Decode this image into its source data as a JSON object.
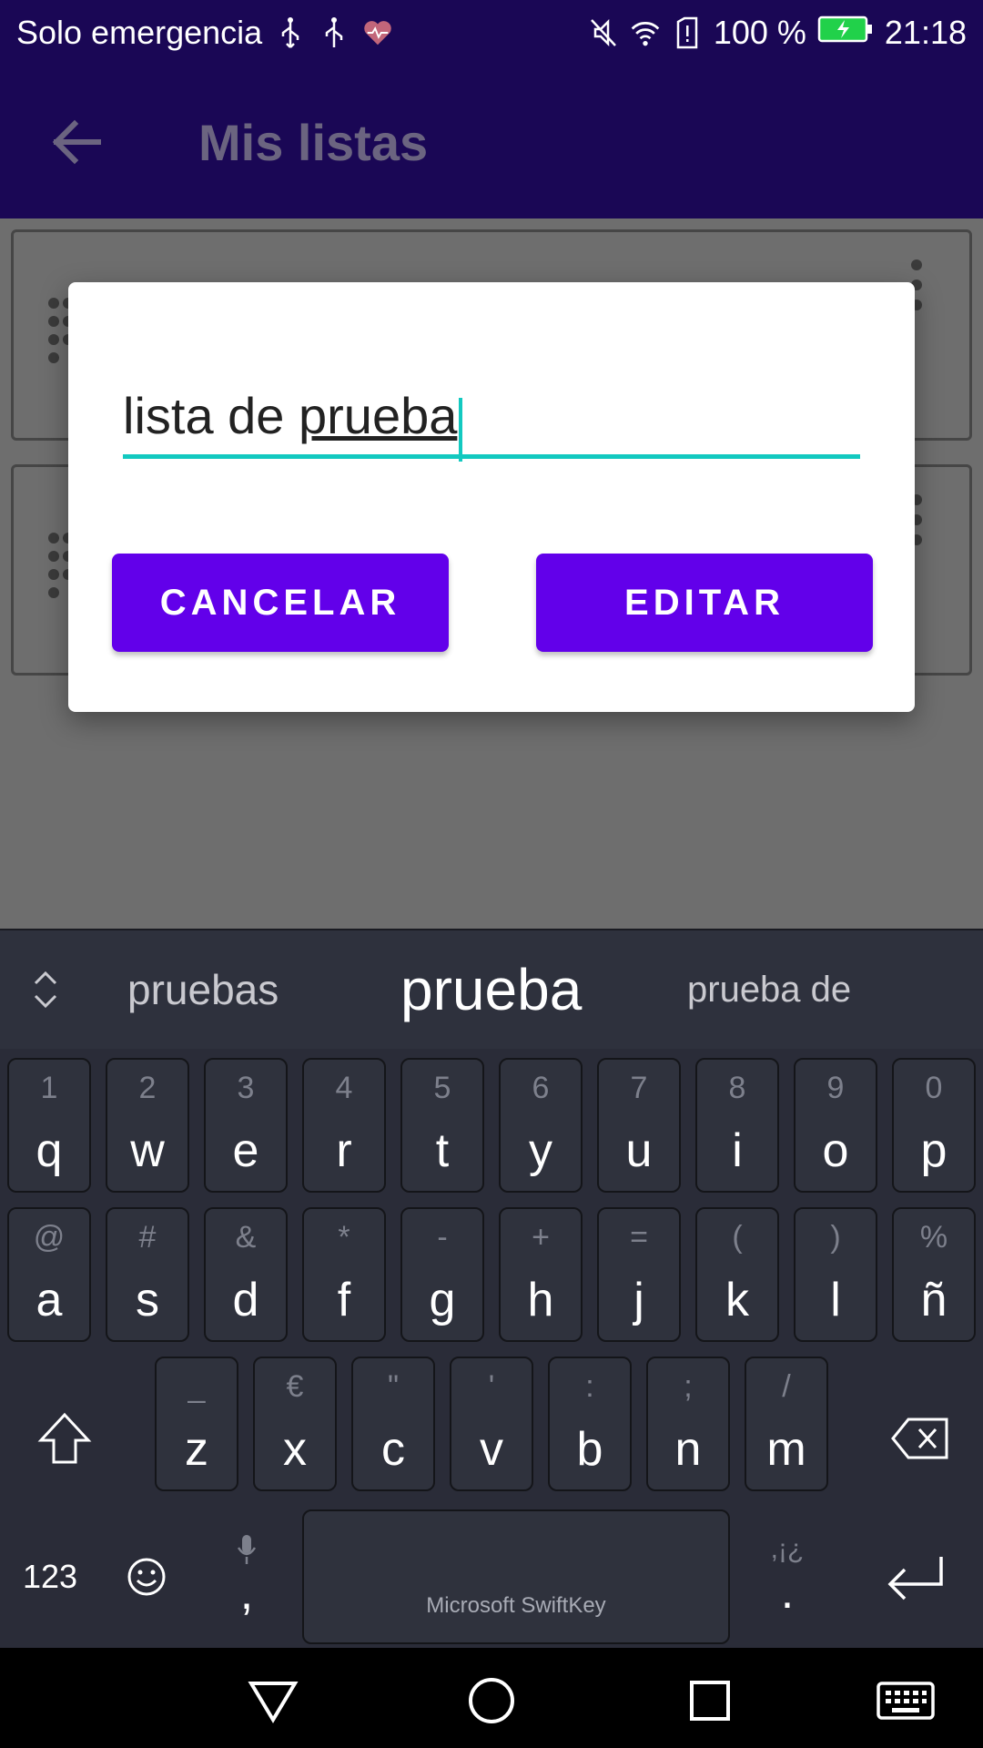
{
  "status": {
    "carrier": "Solo emergencia",
    "battery": "100 %",
    "time": "21:18"
  },
  "appbar": {
    "title": "Mis listas"
  },
  "dialog": {
    "field_prefix": "lista de ",
    "field_word": "prueba",
    "cancel": "CANCELAR",
    "confirm": "EDITAR"
  },
  "fab": {
    "label": "+"
  },
  "keyboard": {
    "suggestions": [
      "pruebas",
      "prueba",
      "prueba de"
    ],
    "row1": [
      {
        "hint": "1",
        "key": "q"
      },
      {
        "hint": "2",
        "key": "w"
      },
      {
        "hint": "3",
        "key": "e"
      },
      {
        "hint": "4",
        "key": "r"
      },
      {
        "hint": "5",
        "key": "t"
      },
      {
        "hint": "6",
        "key": "y"
      },
      {
        "hint": "7",
        "key": "u"
      },
      {
        "hint": "8",
        "key": "i"
      },
      {
        "hint": "9",
        "key": "o"
      },
      {
        "hint": "0",
        "key": "p"
      }
    ],
    "row2": [
      {
        "hint": "@",
        "key": "a"
      },
      {
        "hint": "#",
        "key": "s"
      },
      {
        "hint": "&",
        "key": "d"
      },
      {
        "hint": "*",
        "key": "f"
      },
      {
        "hint": "-",
        "key": "g"
      },
      {
        "hint": "+",
        "key": "h"
      },
      {
        "hint": "=",
        "key": "j"
      },
      {
        "hint": "(",
        "key": "k"
      },
      {
        "hint": ")",
        "key": "l"
      },
      {
        "hint": "%",
        "key": "ñ"
      }
    ],
    "row3": [
      {
        "hint": "_",
        "key": "z"
      },
      {
        "hint": "€",
        "key": "x"
      },
      {
        "hint": "\"",
        "key": "c"
      },
      {
        "hint": "'",
        "key": "v"
      },
      {
        "hint": ":",
        "key": "b"
      },
      {
        "hint": ";",
        "key": "n"
      },
      {
        "hint": "/",
        "key": "m"
      }
    ],
    "numbers_label": "123",
    "comma": ",",
    "period": ".",
    "period_hint": ",¡¿",
    "space_brand": "Microsoft SwiftKey"
  },
  "colors": {
    "primary": "#6200ea",
    "accent": "#13c9c0",
    "appbar": "#1a0755"
  }
}
